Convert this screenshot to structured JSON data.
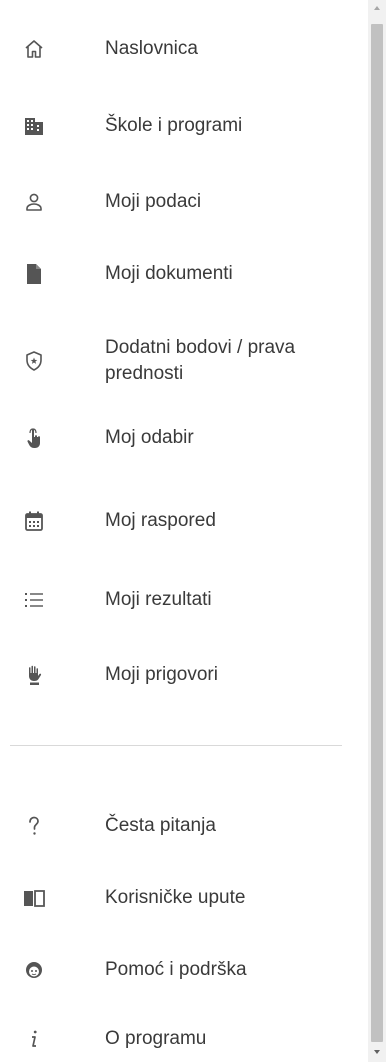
{
  "nav": {
    "items": [
      {
        "label": "Naslovnica",
        "icon": "home-icon"
      },
      {
        "label": "Škole i programi",
        "icon": "building-icon"
      },
      {
        "label": "Moji podaci",
        "icon": "person-icon"
      },
      {
        "label": "Moji dokumenti",
        "icon": "document-icon"
      },
      {
        "label": "Dodatni bodovi / prava prednosti",
        "icon": "shield-star-icon"
      },
      {
        "label": "Moj odabir",
        "icon": "pointing-hand-icon"
      },
      {
        "label": "Moj raspored",
        "icon": "calendar-icon"
      },
      {
        "label": "Moji rezultati",
        "icon": "list-icon"
      },
      {
        "label": "Moji prigovori",
        "icon": "raised-hand-icon"
      }
    ],
    "help_items": [
      {
        "label": "Česta pitanja",
        "icon": "question-icon"
      },
      {
        "label": "Korisničke upute",
        "icon": "book-icon"
      },
      {
        "label": "Pomoć i podrška",
        "icon": "support-face-icon"
      },
      {
        "label": "O programu",
        "icon": "info-icon"
      }
    ]
  },
  "colors": {
    "text": "#3a3a3a",
    "icon": "#555555",
    "divider": "#d9d9d9",
    "scrollbar_thumb": "#c1c1c1"
  }
}
